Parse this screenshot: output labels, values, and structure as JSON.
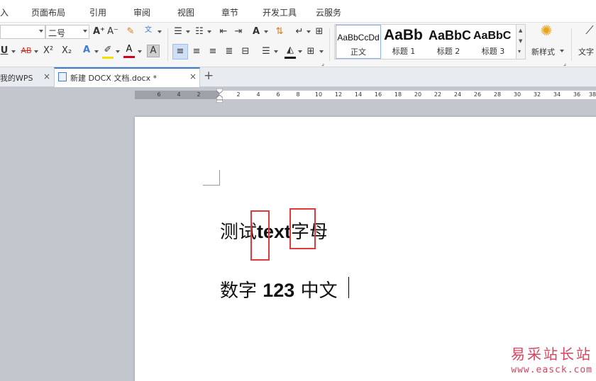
{
  "menu": {
    "items": [
      "入",
      "页面布局",
      "引用",
      "审阅",
      "视图",
      "章节",
      "开发工具",
      "云服务"
    ]
  },
  "toolbar": {
    "font_name_value": "",
    "font_size_value": "二号",
    "icons": [
      "grow-font",
      "shrink-font",
      "clear-format",
      "phonetic-guide",
      "bullets",
      "numbering",
      "decrease-indent",
      "increase-indent",
      "text-direction",
      "sort",
      "show-marks",
      "table-border",
      "underline",
      "strikethrough",
      "superscript",
      "subscript",
      "text-effect",
      "highlight",
      "font-color",
      "char-shading",
      "align-left",
      "align-center",
      "align-right",
      "justify",
      "distributed",
      "line-spacing",
      "shading",
      "borders"
    ],
    "labels": {
      "underline": "U",
      "strikethrough": "AB",
      "superscript": "X²",
      "subscript": "X₂",
      "text_effect": "A",
      "font_color": "A",
      "grow_font": "A⁺",
      "shrink_font": "A⁻"
    },
    "styles": [
      {
        "sample": "AaBbCcDd",
        "name": "正文"
      },
      {
        "sample": "AaBb",
        "name": "标题 1"
      },
      {
        "sample": "AaBbC",
        "name": "标题 2"
      },
      {
        "sample": "AaBbC",
        "name": "标题 3"
      }
    ],
    "new_style_label": "新样式",
    "text_tool_label": "文字"
  },
  "tabs": [
    {
      "label": "我的WPS",
      "close": "×"
    },
    {
      "label": "新建 DOCX 文档.docx *",
      "close": "×"
    }
  ],
  "new_tab_label": "+",
  "ruler": {
    "labels": [
      "6",
      "4",
      "2",
      "2",
      "4",
      "6",
      "8",
      "10",
      "12",
      "14",
      "16",
      "18",
      "20",
      "22",
      "24",
      "26",
      "28",
      "30",
      "32",
      "34",
      "36",
      "38"
    ]
  },
  "document": {
    "line1": {
      "part1": "测试",
      "part2": "text",
      "part3": "字母"
    },
    "line2": {
      "part1": "数字 ",
      "part2": "123",
      "part3": " 中文"
    }
  },
  "watermark": {
    "title": "易采站长站",
    "url": "www.easck.com"
  },
  "colors": {
    "highlight_box": "#e03a3a",
    "accent_tab": "#3d7bd4",
    "font_color_underline": "#d0021b",
    "watermark": "#d6435d"
  }
}
